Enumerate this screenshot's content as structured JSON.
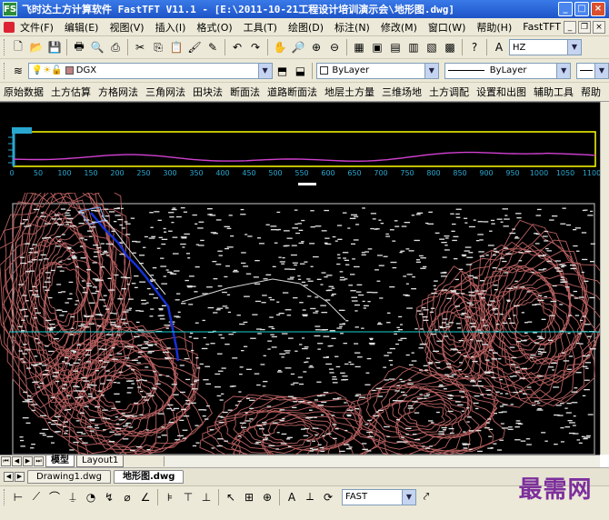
{
  "window": {
    "title": "飞时达土方计算软件 FastTFT V11.1 - [E:\\2011-10-21工程设计培训演示会\\地形图.dwg]",
    "app_icon": "FS"
  },
  "menubar": {
    "items": [
      "文件(F)",
      "编辑(E)",
      "视图(V)",
      "插入(I)",
      "格式(O)",
      "工具(T)",
      "绘图(D)",
      "标注(N)",
      "修改(M)",
      "窗口(W)",
      "帮助(H)",
      "FastTFT"
    ]
  },
  "toolbar": {
    "text_style_value": "HZ"
  },
  "layers": {
    "current_layer": "DGX",
    "color": "ByLayer",
    "linetype": "ByLayer"
  },
  "fast_menu": {
    "items": [
      "原始数据",
      "土方估算",
      "方格网法",
      "三角网法",
      "田块法",
      "断面法",
      "道路断面法",
      "地层土方量",
      "三维场地",
      "土方调配",
      "设置和出图",
      "辅助工具",
      "帮助"
    ]
  },
  "profile": {
    "x_ticks": [
      "0",
      "50",
      "100",
      "150",
      "200",
      "250",
      "300",
      "350",
      "400",
      "450",
      "500",
      "550",
      "600",
      "650",
      "700",
      "750",
      "800",
      "850",
      "900",
      "950",
      "1000",
      "1050",
      "1100"
    ],
    "line_color": "#d040d0",
    "tick_color": "#2aa7d0",
    "frame_color": "#ffff00"
  },
  "drawing": {
    "bg_color": "#000000",
    "contour_color": "#b86060",
    "river_color": "#1530d8",
    "label_color": "#e0e0e0"
  },
  "layout_tabs": [
    "模型",
    "Layout1"
  ],
  "doc_tabs": [
    "Drawing1.dwg",
    "地形图.dwg"
  ],
  "bottom_toolbar": {
    "snap_mode": "FAST"
  },
  "watermark": "最需网",
  "colors": {
    "titlebar": "#1d54c8",
    "chrome": "#ece9d8"
  }
}
